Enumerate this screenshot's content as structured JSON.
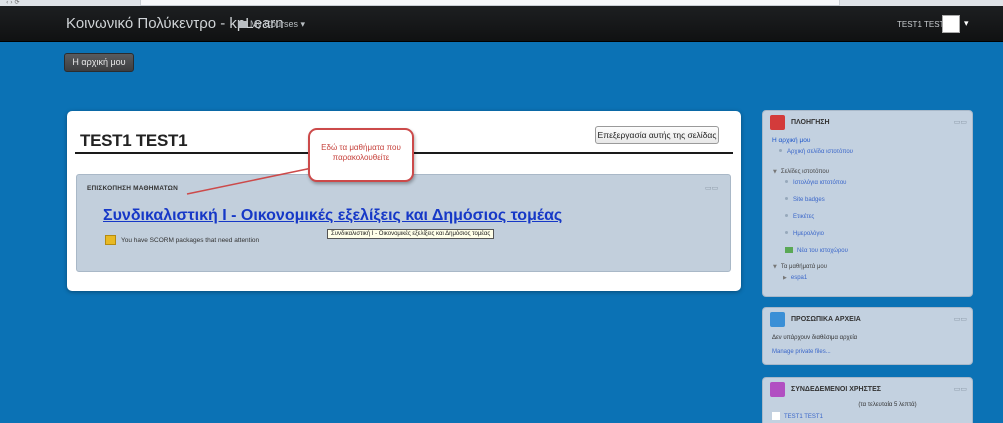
{
  "navbar": {
    "brand": "Κοινωνικό Πολύκεντρο - kpLearn",
    "my_courses": "My Courses",
    "user_name": "TEST1 TEST1"
  },
  "home_button": "Η αρχική μου",
  "main": {
    "title": "TEST1 TEST1",
    "edit_button": "Επεξεργασία αυτής της σελίδας",
    "overview": {
      "heading": "ΕΠΙΣΚΟΠΗΣΗ ΜΑΘΗΜΑΤΩΝ",
      "course_link": "Συνδικαλιστική Ι - Οικονομικές εξελίξεις και Δημόσιος τομέας",
      "tooltip": "Συνδικαλιστική Ι - Οικονομικές εξελίξεις και Δημόσιος τομέας",
      "scorm_notice": "You have SCORM packages that need attention"
    },
    "callout": "Εδώ τα μαθήματα που παρακολουθείτε"
  },
  "navigation": {
    "title": "ΠΛΟΗΓΗΣΗ",
    "home": "Η αρχική μου",
    "site_home": "Αρχική σελίδα ιστοτόπου",
    "site_pages": "Σελίδες ιστοτόπου",
    "blogs": "Ιστολόγια ιστοτόπου",
    "badges": "Site badges",
    "tags": "Ετικέτες",
    "calendar": "Ημερολόγιο",
    "news": "Νέα του ιστοχώρου",
    "my_courses": "Τα μαθήματά μου",
    "course": "espa1"
  },
  "private_files": {
    "title": "ΠΡΟΣΩΠΙΚΑ ΑΡΧΕΙΑ",
    "empty": "Δεν υπάρχουν διαθέσιμα αρχεία",
    "manage": "Manage private files..."
  },
  "online_users": {
    "title": "ΣΥΝΔΕΔΕΜΕΝΟΙ ΧΡΗΣΤΕΣ",
    "last": "(τα τελευταία 5 λεπτά)",
    "user": "TEST1 TEST1"
  },
  "colors": {
    "page_bg": "#0b72b5",
    "navbar_bg": "#1d1f21",
    "block_bg": "#c3d1e0",
    "link": "#1638c7",
    "callout": "#cc4a4a"
  }
}
